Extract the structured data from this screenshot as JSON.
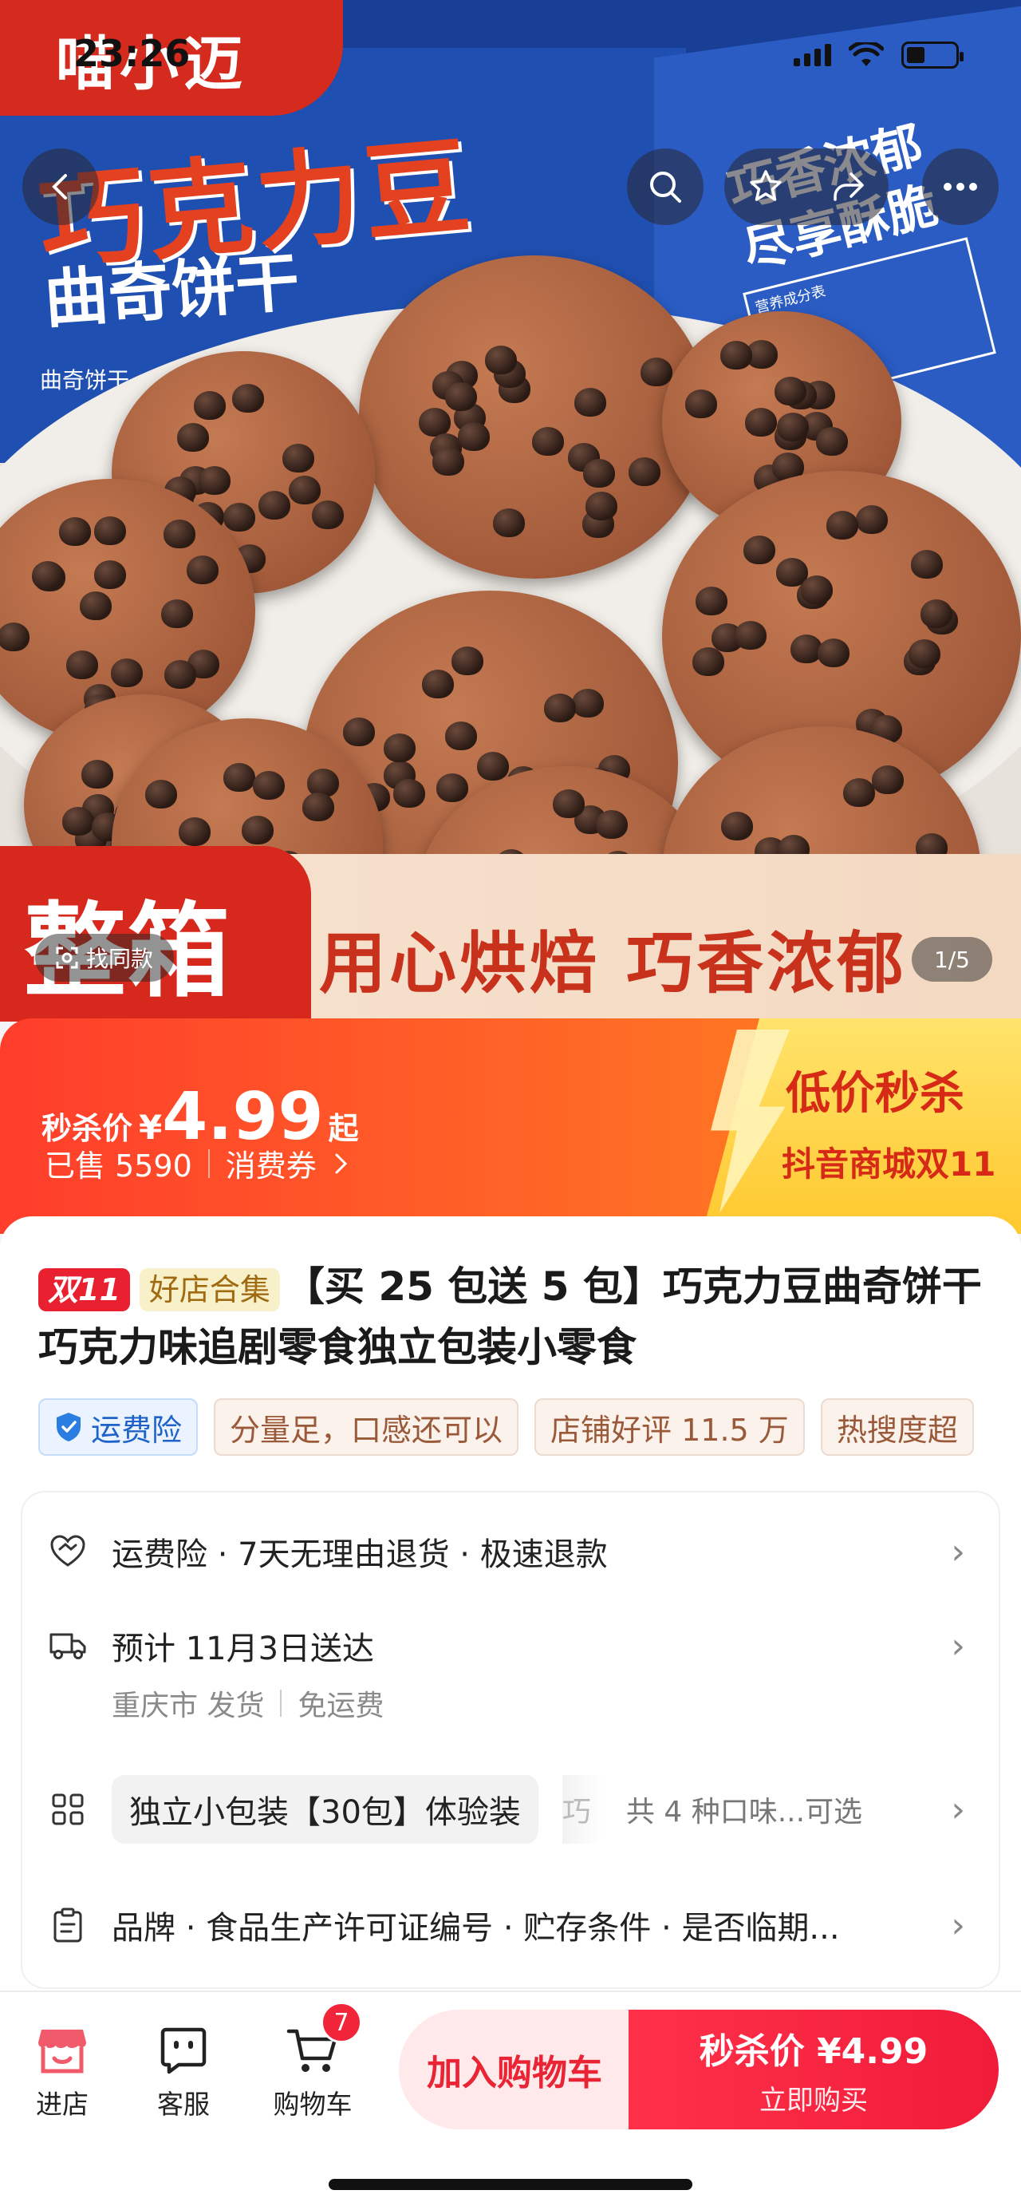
{
  "status_bar": {
    "time": "23:26"
  },
  "hero": {
    "brand": "喵小迈",
    "box_title": "巧克力豆",
    "box_subtitle": "曲奇饼干",
    "box_small": "曲奇饼干",
    "side_line1": "巧香浓郁",
    "side_line2": "尽享酥脆",
    "nutrition_title": "营养成分表",
    "band_big": "整箱",
    "band_slogan": "用心烘焙  巧香浓郁",
    "find_same": "找同款",
    "counter": "1/5"
  },
  "price": {
    "label": "秒杀价",
    "currency": "¥",
    "amount": "4.99",
    "suffix": "起",
    "sold": "已售 5590",
    "coupon": "消费券",
    "promo_title": "低价秒杀",
    "promo_sub": "抖音商城双11"
  },
  "product": {
    "tag_double": "双11",
    "tag_shop": "好店合集",
    "title": "【买 25 包送 5 包】巧克力豆曲奇饼干巧克力味追剧零食独立包装小零食",
    "chips": [
      "运费险",
      "分量足，口感还可以",
      "店铺好评 11.5 万",
      "热搜度超"
    ]
  },
  "rows": {
    "guarantee": "运费险 · 7天无理由退货 · 极速退款",
    "delivery": "预计 11月3日送达",
    "ship_from": "重庆市 发货",
    "shipping_fee": "免运费",
    "spec_selected": "独立小包装【30包】体验装",
    "spec_thumb": "巧",
    "spec_count": "共 4 种口味...可选",
    "params": "品牌 · 食品生产许可证编号 · 贮存条件 · 是否临期..."
  },
  "bottom_bar": {
    "store": "进店",
    "service": "客服",
    "cart": "购物车",
    "cart_count": "7",
    "add_cart": "加入购物车",
    "buy_price": "秒杀价 ¥4.99",
    "buy_label": "立即购买"
  },
  "colors": {
    "accent": "#f01c3a",
    "flash_orange": "#ff5a26",
    "promo_yellow": "#ffd84a"
  }
}
